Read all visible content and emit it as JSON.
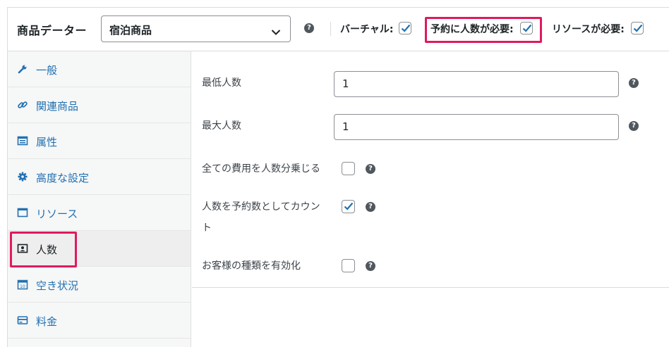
{
  "header": {
    "title": "商品データー",
    "product_type": {
      "selected": "宿泊商品"
    },
    "options": [
      {
        "label": "バーチャル:",
        "checked": true
      },
      {
        "label": "予約に人数が必要:",
        "checked": true,
        "highlighted": true
      },
      {
        "label": "リソースが必要:",
        "checked": true
      }
    ]
  },
  "sidebar": {
    "items": [
      {
        "label": "一般",
        "icon": "wrench-icon"
      },
      {
        "label": "関連商品",
        "icon": "link-icon"
      },
      {
        "label": "属性",
        "icon": "list-icon"
      },
      {
        "label": "高度な設定",
        "icon": "gear-icon"
      },
      {
        "label": "リソース",
        "icon": "window-icon"
      },
      {
        "label": "人数",
        "icon": "person-card-icon",
        "active": true,
        "highlighted": true
      },
      {
        "label": "空き状況",
        "icon": "calendar-icon"
      },
      {
        "label": "料金",
        "icon": "card-icon"
      }
    ]
  },
  "form": {
    "min_persons": {
      "label": "最低人数",
      "value": "1"
    },
    "max_persons": {
      "label": "最大人数",
      "value": "1"
    },
    "multiply_costs": {
      "label": "全ての費用を人数分乗じる",
      "checked": false
    },
    "count_as_booking": {
      "label_line1": "人数を予約数としてカウン",
      "label_line2": "ト",
      "checked": true
    },
    "person_types": {
      "label": "お客様の種類を有効化",
      "checked": false
    }
  },
  "help_glyph": "?",
  "colors": {
    "accent": "#2271b1",
    "highlight": "#e0195f",
    "active_bg": "#eeeeee"
  }
}
